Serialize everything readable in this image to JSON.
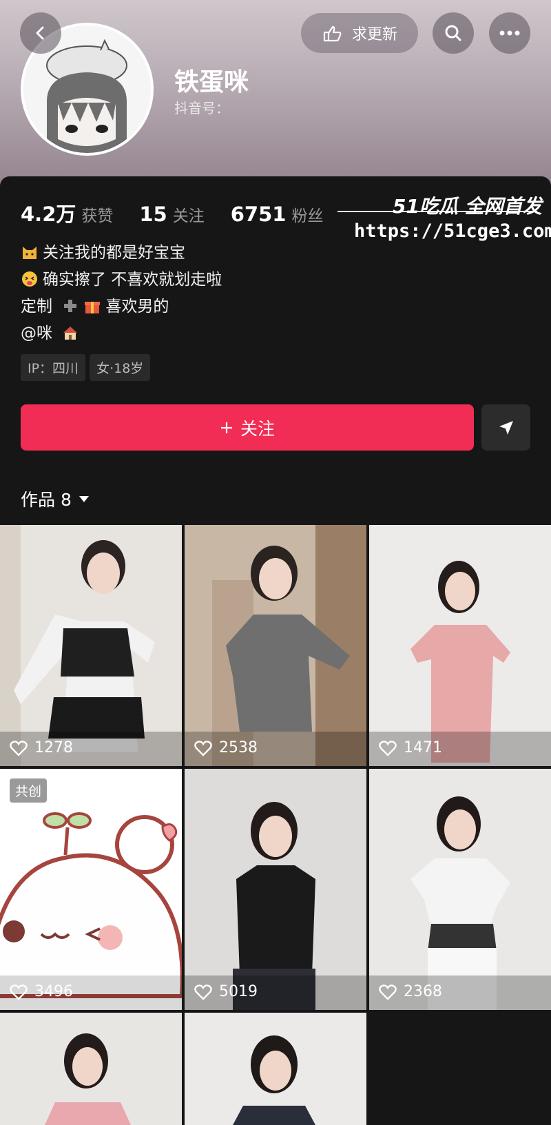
{
  "header": {
    "refresh_label": "求更新",
    "username": "铁蛋咪",
    "douyin_id_label": "抖音号："
  },
  "stats": [
    {
      "value": "4.2万",
      "label": "获赞"
    },
    {
      "value": "15",
      "label": "关注"
    },
    {
      "value": "6751",
      "label": "粉丝"
    }
  ],
  "watermark": {
    "brand": "51吃瓜 全网首发",
    "url": "https://51cge3.com"
  },
  "bio": {
    "line1": "关注我的都是好宝宝",
    "line2": "确实擦了 不喜欢就划走啦",
    "line3a": "定制",
    "line3b": "喜欢男的",
    "line4": "@咪"
  },
  "tags": {
    "ip": "IP：四川",
    "gender_age": "女·18岁"
  },
  "actions": {
    "follow_label": "关注"
  },
  "works": {
    "label": "作品 8"
  },
  "posts": [
    {
      "likes": "1278",
      "badge": ""
    },
    {
      "likes": "2538",
      "badge": ""
    },
    {
      "likes": "1471",
      "badge": ""
    },
    {
      "likes": "3496",
      "badge": "共创"
    },
    {
      "likes": "5019",
      "badge": ""
    },
    {
      "likes": "2368",
      "badge": ""
    },
    {
      "likes": "",
      "badge": ""
    },
    {
      "likes": "",
      "badge": ""
    }
  ],
  "colors": {
    "accent": "#f12d55",
    "background": "#161616"
  }
}
